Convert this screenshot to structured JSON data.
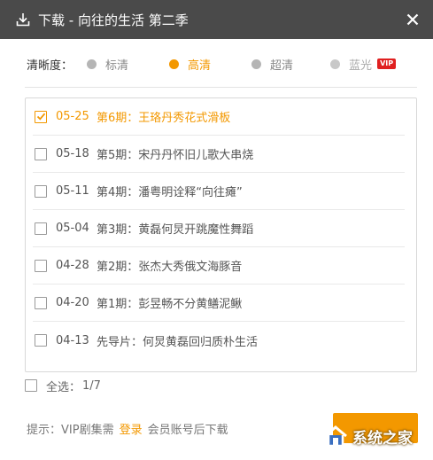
{
  "window": {
    "title": "下载 - 向往的生活 第二季",
    "download_icon": "download-icon",
    "close_icon": "close-icon",
    "background": "#4a4a4a"
  },
  "quality": {
    "label": "清晰度：",
    "options": [
      {
        "label": "标清",
        "state": "normal"
      },
      {
        "label": "高清",
        "state": "selected"
      },
      {
        "label": "超清",
        "state": "normal"
      },
      {
        "label": "蓝光",
        "state": "disabled",
        "badge": "VIP"
      }
    ],
    "accent_color": "#f39800",
    "vip_color": "#e02020"
  },
  "episodes": [
    {
      "date": "05-25",
      "title": "第6期：王珞丹秀花式滑板",
      "checked": true
    },
    {
      "date": "05-18",
      "title": "第5期：宋丹丹怀旧儿歌大串烧",
      "checked": false
    },
    {
      "date": "05-11",
      "title": "第4期：潘粤明诠释“向往瘫”",
      "checked": false
    },
    {
      "date": "05-04",
      "title": "第3期：黄磊何炅开跳魔性舞蹈",
      "checked": false
    },
    {
      "date": "04-28",
      "title": "第2期：张杰大秀俄文海豚音",
      "checked": false
    },
    {
      "date": "04-20",
      "title": "第1期：彭昱畅不分黄鳝泥鳅",
      "checked": false
    },
    {
      "date": "04-13",
      "title": "先导片：何炅黄磊回归质朴生活",
      "checked": false
    }
  ],
  "select_all": {
    "label": "全选：",
    "count": "1/7",
    "checked": false
  },
  "tip": {
    "prefix": "提示：VIP剧集需",
    "login": "登录",
    "suffix": "会员账号后下载"
  },
  "watermark": {
    "text": "系统之家",
    "logo": "house-logo-icon"
  }
}
